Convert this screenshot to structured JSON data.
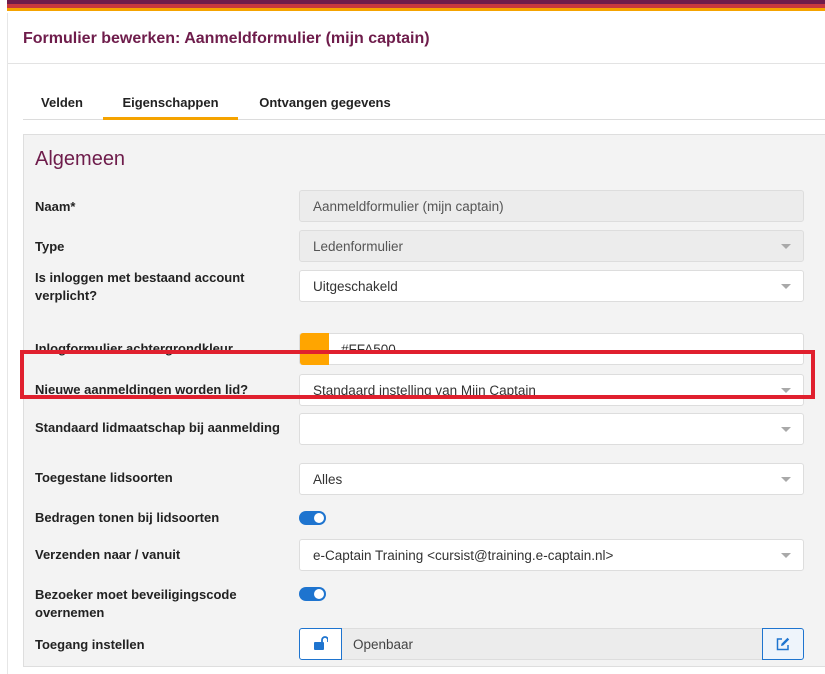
{
  "page": {
    "title": "Formulier bewerken: Aanmeldformulier (mijn captain)"
  },
  "tabs": [
    {
      "label": "Velden"
    },
    {
      "label": "Eigenschappen"
    },
    {
      "label": "Ontvangen gegevens"
    }
  ],
  "section": {
    "title": "Algemeen"
  },
  "fields": {
    "naam": {
      "label": "Naam*",
      "value": "Aanmeldformulier (mijn captain)"
    },
    "type": {
      "label": "Type",
      "value": "Ledenformulier"
    },
    "inloggen": {
      "label": "Is inloggen met bestaand account verplicht?",
      "value": "Uitgeschakeld"
    },
    "achtergrondkleur": {
      "label": "Inlogformulier achtergrondkleur",
      "value": "#FFA500",
      "swatch_color": "#FFA500"
    },
    "nieuwe_aanmeldingen": {
      "label": "Nieuwe aanmeldingen worden lid?",
      "value": "Standaard instelling van Mijn Captain"
    },
    "standaard_lidmaatschap": {
      "label": "Standaard lidmaatschap bij aanmelding",
      "value": ""
    },
    "lidsoorten": {
      "label": "Toegestane lidsoorten",
      "value": "Alles"
    },
    "bedragen": {
      "label": "Bedragen tonen bij lidsoorten",
      "enabled": true
    },
    "verzenden": {
      "label": "Verzenden naar / vanuit",
      "value": "e-Captain Training <cursist@training.e-captain.nl>"
    },
    "beveiligingscode": {
      "label": "Bezoeker moet beveiligingscode overnemen",
      "enabled": true
    },
    "toegang": {
      "label": "Toegang instellen",
      "value": "Openbaar"
    }
  },
  "colors": {
    "brand": "#6e1c4b",
    "accent": "#f5a300",
    "primary": "#1e74cf",
    "highlight": "#e0202e"
  },
  "icons": {
    "lock": "unlock-icon",
    "edit": "edit-icon",
    "caret": "chevron-down-icon"
  }
}
